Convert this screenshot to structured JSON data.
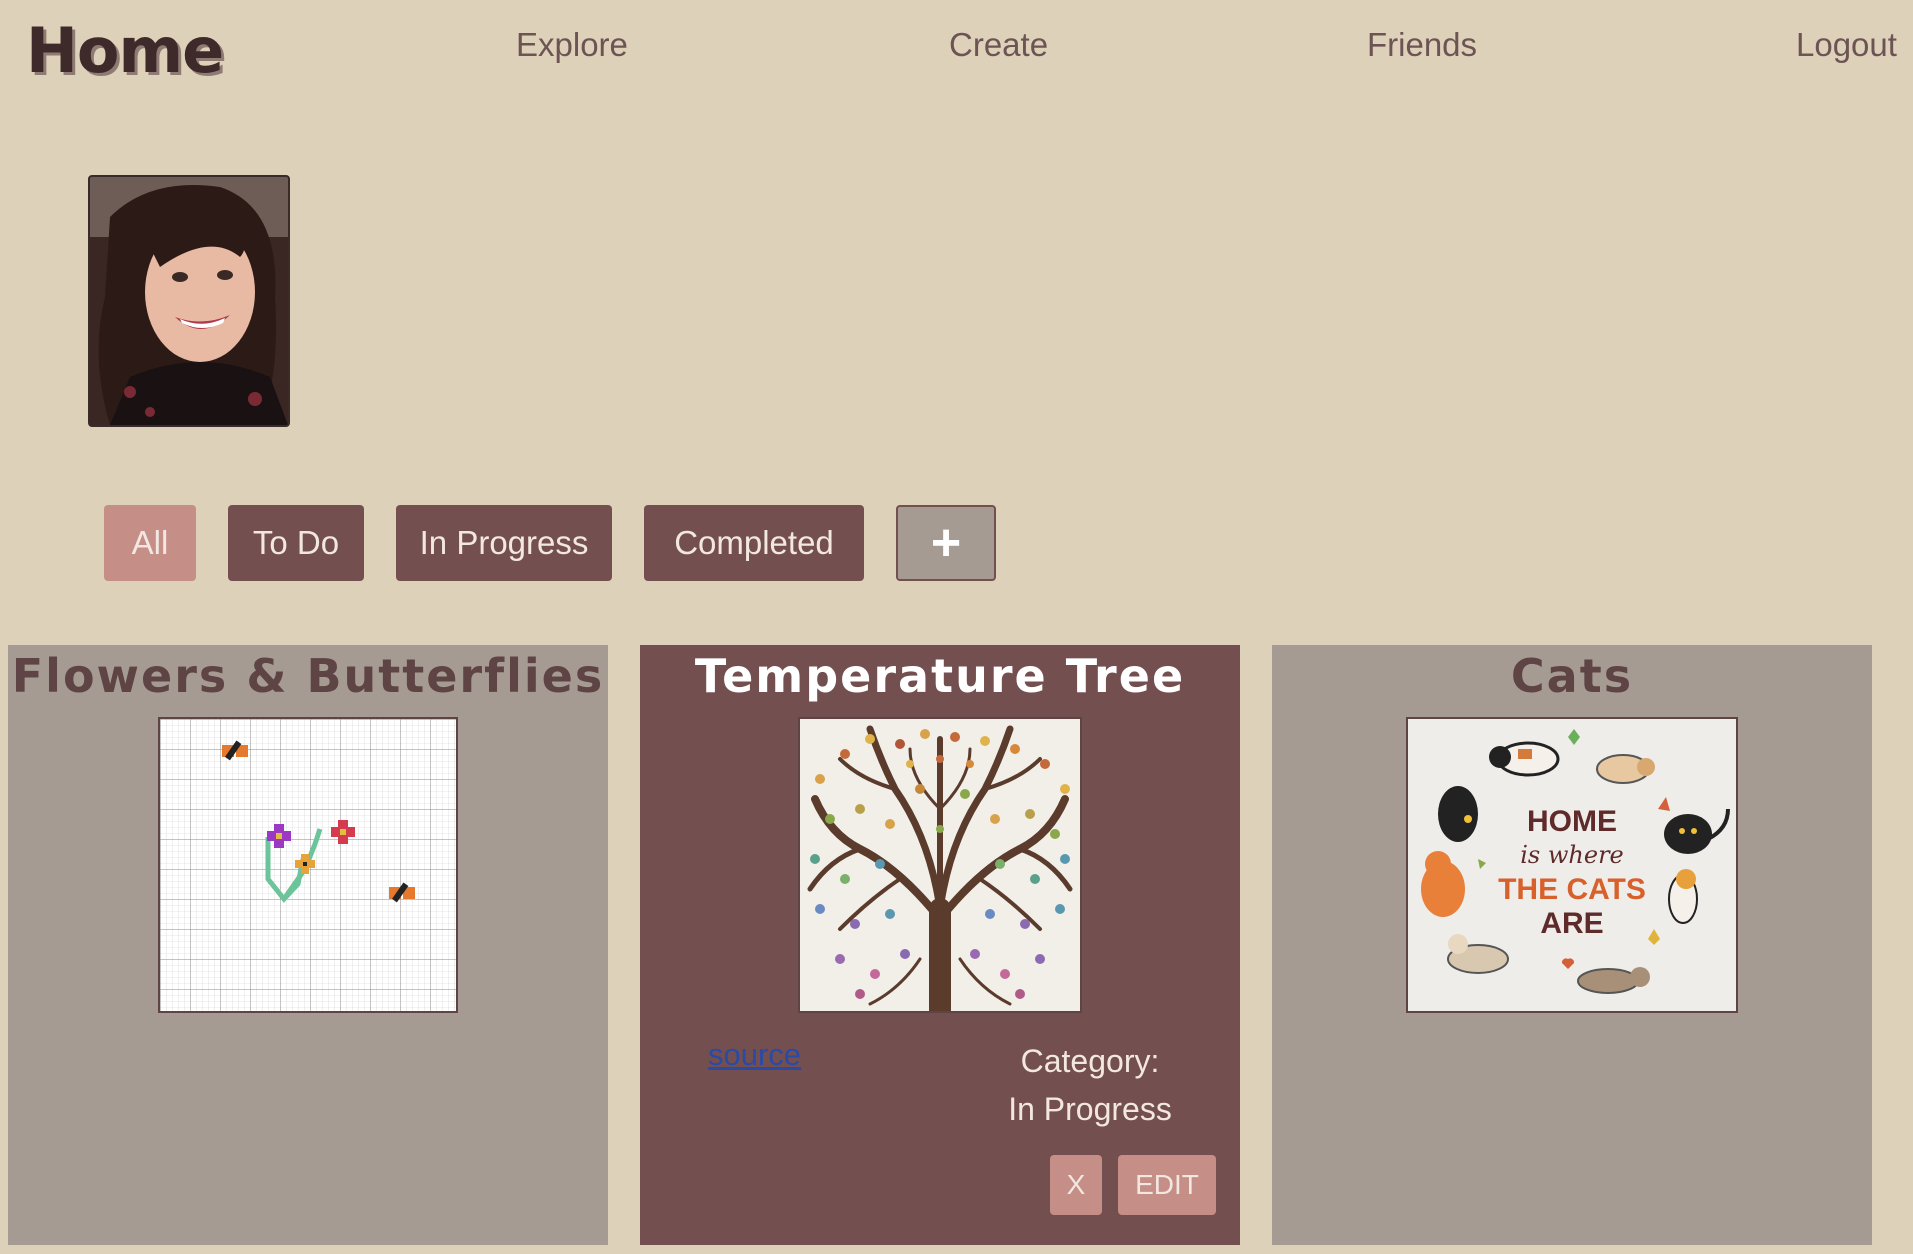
{
  "nav": {
    "logo": "Home",
    "links": [
      "Explore",
      "Create",
      "Friends",
      "Logout"
    ]
  },
  "filters": {
    "all": "All",
    "todo": "To Do",
    "in_progress": "In Progress",
    "completed": "Completed",
    "add": "+"
  },
  "cards": [
    {
      "title": "Flowers & Butterflies"
    },
    {
      "title": "Temperature Tree",
      "source_label": "source",
      "category_label": "Category:",
      "category_value": "In Progress",
      "delete_label": "X",
      "edit_label": "EDIT"
    },
    {
      "title": "Cats",
      "art_text": [
        "HOME",
        "is where",
        "THE CATS",
        "ARE"
      ]
    }
  ],
  "colors": {
    "background": "#ded1b9",
    "dark_card": "#744f4f",
    "grey_card": "#a69b93",
    "accent": "#c58e86",
    "link": "#2a4aa8"
  }
}
